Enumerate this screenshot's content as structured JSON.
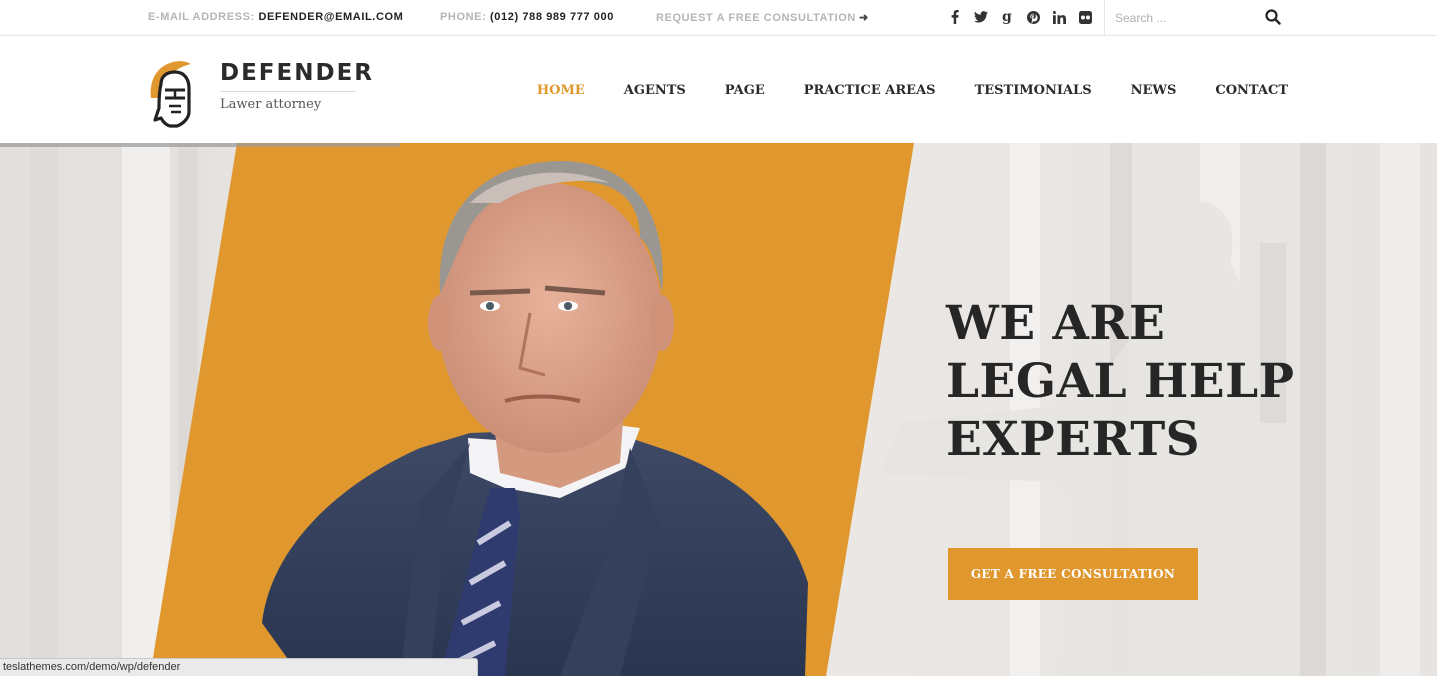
{
  "topbar": {
    "email_label": "E-MAIL ADDRESS:",
    "email_value": "DEFENDER@EMAIL.COM",
    "phone_label": "PHONE:",
    "phone_value": "(012) 788 989 777 000",
    "consult_link": "REQUEST A FREE CONSULTATION",
    "consult_arrow": "➜",
    "socials": [
      {
        "name": "facebook-icon",
        "glyph": "f"
      },
      {
        "name": "twitter-icon",
        "glyph": "🐦"
      },
      {
        "name": "google-plus-icon",
        "glyph": "g"
      },
      {
        "name": "pinterest-icon",
        "glyph": "P"
      },
      {
        "name": "linkedin-icon",
        "glyph": "in"
      },
      {
        "name": "flickr-icon",
        "glyph": "●●"
      }
    ],
    "search_placeholder": "Search ..."
  },
  "header": {
    "logo_name": "DEFENDER",
    "logo_tagline": "Lawer attorney",
    "nav": [
      {
        "label": "HOME",
        "active": true
      },
      {
        "label": "AGENTS",
        "active": false
      },
      {
        "label": "PAGE",
        "active": false
      },
      {
        "label": "PRACTICE AREAS",
        "active": false
      },
      {
        "label": "TESTIMONIALS",
        "active": false
      },
      {
        "label": "NEWS",
        "active": false
      },
      {
        "label": "CONTACT",
        "active": false
      }
    ]
  },
  "hero": {
    "title_line1": "WE ARE",
    "title_line2": "LEGAL HELP",
    "title_line3": "EXPERTS",
    "cta_label": "GET A FREE CONSULTATION"
  },
  "browser": {
    "status_url": "teslathemes.com/demo/wp/defender"
  },
  "colors": {
    "accent": "#e0982e",
    "text_dark": "#2b2b2b",
    "muted": "#b5b5b5",
    "hero_bg": "#e9e6e3"
  }
}
